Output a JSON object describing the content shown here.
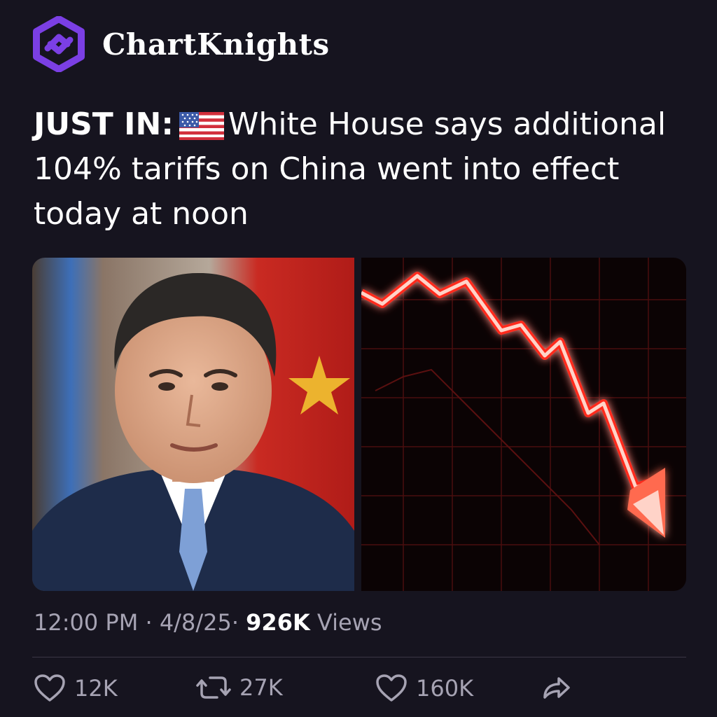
{
  "account": {
    "name": "ChartKnights",
    "logo_icon": "hexagon-logo-icon",
    "brand_color": "#7b3fe4"
  },
  "post": {
    "prefix": "JUST IN:",
    "flag_icon": "us-flag-icon",
    "text": "White House says additional 104% tariffs on China went into effect today at noon"
  },
  "media": {
    "left_image": "portrait-photo",
    "right_image": "red-falling-chart-graphic",
    "chart_color": "#ff2a1a"
  },
  "meta": {
    "time": "12:00 PM",
    "sep": "·",
    "date": "4/8/25",
    "views_count": "926K",
    "views_label": "Views"
  },
  "actions": {
    "reply": {
      "icon": "heart-icon",
      "count": "12K"
    },
    "repost": {
      "icon": "repost-icon",
      "count": "27K"
    },
    "like": {
      "icon": "heart-icon",
      "count": "160K"
    },
    "share": {
      "icon": "share-icon"
    }
  },
  "colors": {
    "background": "#16141f",
    "muted_text": "#a6a3b3"
  }
}
